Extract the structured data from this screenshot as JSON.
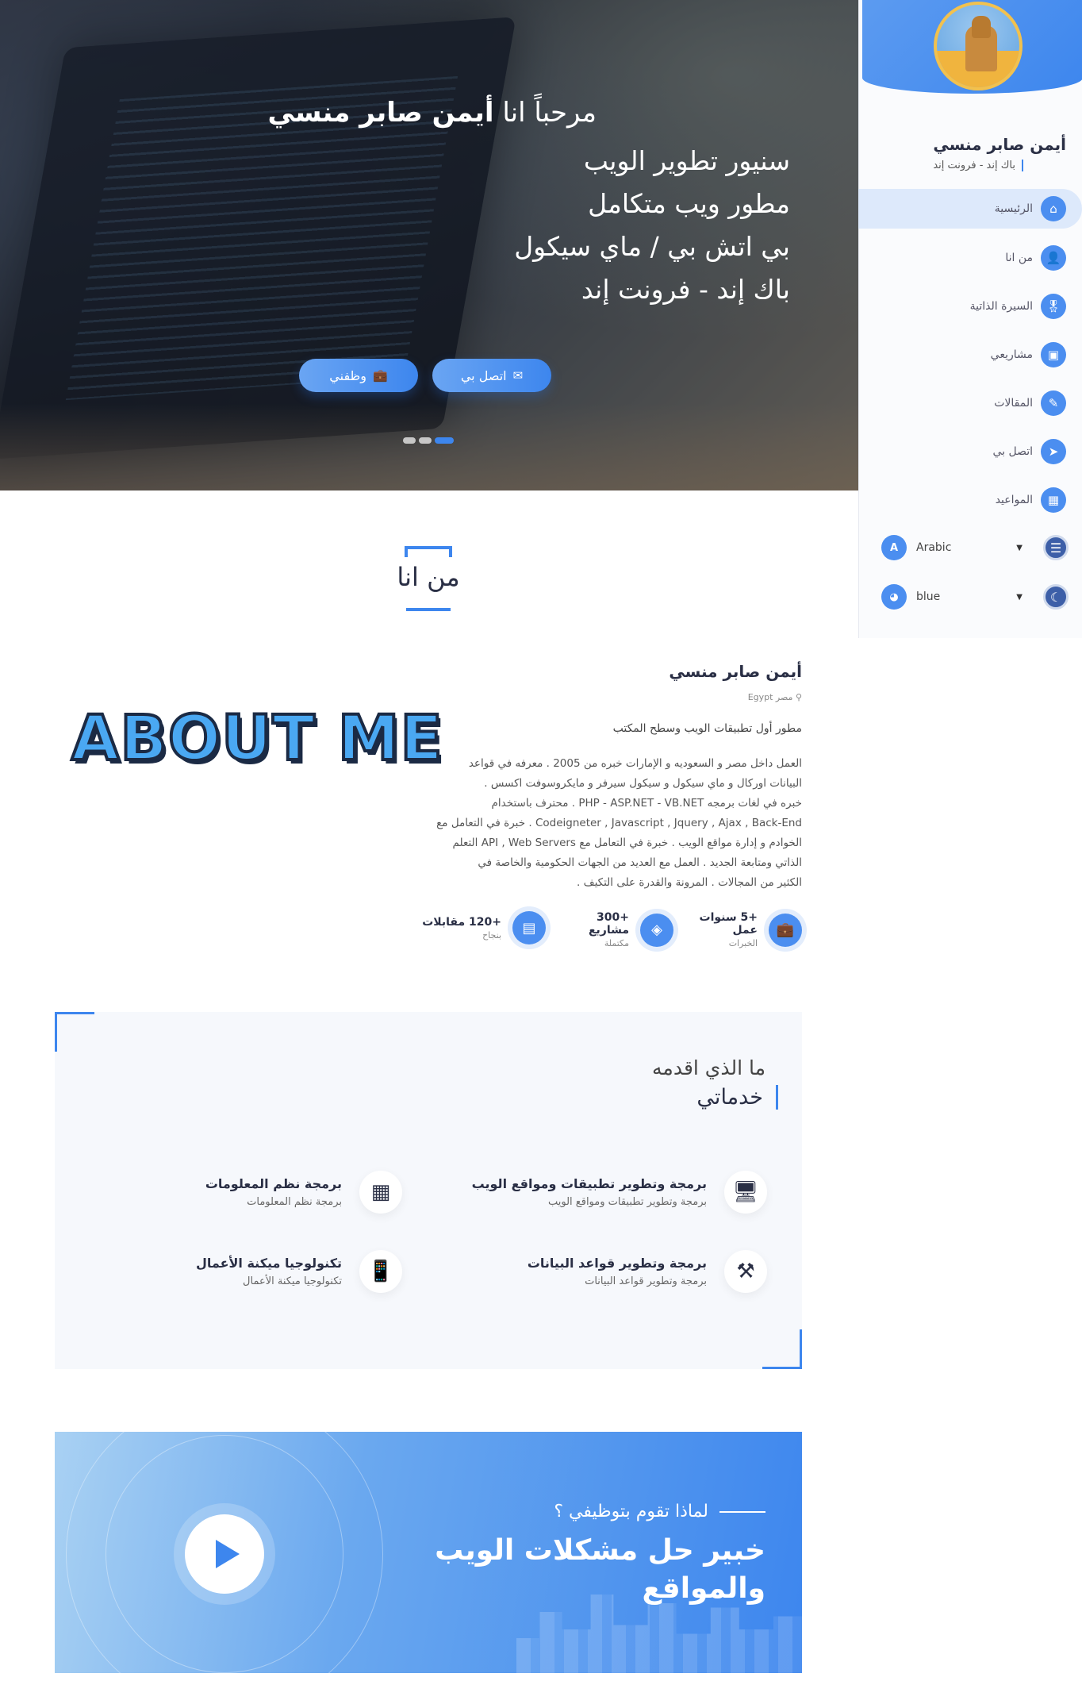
{
  "hero": {
    "greeting_prefix": "مرحباً انا",
    "greeting_name": "أيمن صابر منسي",
    "lines": [
      "سنيور تطوير الويب",
      "مطور ويب متكامل",
      "بي اتش بي / ماي سيكول",
      "باك إند - فرونت إند"
    ],
    "contact_button": "اتصل بي",
    "hire_button": "وظفني",
    "slides": 3,
    "active_slide": 3
  },
  "sidebar": {
    "name": "أيمن صابر منسي",
    "subtitle": "باك إند - فرونت إند",
    "nav": [
      {
        "label": "الرئيسية",
        "icon": "home-icon",
        "active": true
      },
      {
        "label": "من انا",
        "icon": "user-icon"
      },
      {
        "label": "السيرة الذاتية",
        "icon": "badge-icon"
      },
      {
        "label": "مشاريعي",
        "icon": "projects-icon"
      },
      {
        "label": "المقالات",
        "icon": "articles-icon"
      },
      {
        "label": "اتصل بي",
        "icon": "send-icon"
      },
      {
        "label": "المواعيد",
        "icon": "calendar-icon"
      }
    ],
    "language": {
      "value": "Arabic",
      "icon": "translate-icon"
    },
    "theme": {
      "value": "blue",
      "icon": "palette-icon"
    }
  },
  "about": {
    "section_title": "من انا",
    "art_text": "ABOUT ME",
    "name": "أيمن صابر منسي",
    "location": "مصر Egypt",
    "role": "مطور أول تطبيقات الويب وسطح المكتب",
    "bio": [
      "العمل داخل مصر و السعوديه و الإمارات خبره من 2005 . معرفه في قواعد",
      "البيانات اوركال و ماي سيكول و سيكول سيرفر و مايكروسوفت اكسس .",
      "خبره في لغات برمجه PHP - ASP.NET - VB.NET . محترف باستخدام",
      "Codeigneter , Javascript , Jquery , Ajax , Back-End . خبرة في التعامل مع",
      "الخوادم و إدارة مواقع الويب . خبرة في التعامل مع API , Web Servers التعلم",
      "الذاتي ومتابعة الجديد . العمل مع العديد من الجهات الحكومية والخاصة في",
      "الكثير من المجالات . المرونة والقدرة على التكيف ."
    ],
    "stats": [
      {
        "num": "+5 سنوات",
        "label": "عمل",
        "sub": "الخبرات",
        "icon": "briefcase-icon"
      },
      {
        "num": "+300",
        "label": "مشاريع",
        "sub": "مكتملة",
        "icon": "layers-icon"
      },
      {
        "num": "+120 مقابلات",
        "label": "",
        "sub": "بنجاح",
        "icon": "document-icon"
      }
    ]
  },
  "services": {
    "eyebrow": "ما الذي اقدمه",
    "title": "خدماتي",
    "items": [
      {
        "name": "برمجة وتطوير تطبيقات ومواقع الويب",
        "desc": "برمجة وتطوير تطبيقات ومواقع الويب",
        "icon": "web-dev-icon"
      },
      {
        "name": "برمجة نظم المعلومات",
        "desc": "برمجة نظم المعلومات",
        "icon": "chip-icon"
      },
      {
        "name": "برمجة وتطوير قواعد البيانات",
        "desc": "برمجة وتطوير قواعد البيانات",
        "icon": "database-tools-icon"
      },
      {
        "name": "تكنولوجيا ميكنة الأعمال",
        "desc": "تكنولوجيا ميكنة الأعمال",
        "icon": "mobile-hand-icon"
      }
    ]
  },
  "cta": {
    "eyebrow": "لماذا تقوم بتوظيفي ؟",
    "title": "خبير حل مشكلات الويب والمواقع"
  },
  "colors": {
    "accent": "#3d86ee",
    "accent_light": "#6aa5f3",
    "panel": "#f6f8fc"
  }
}
